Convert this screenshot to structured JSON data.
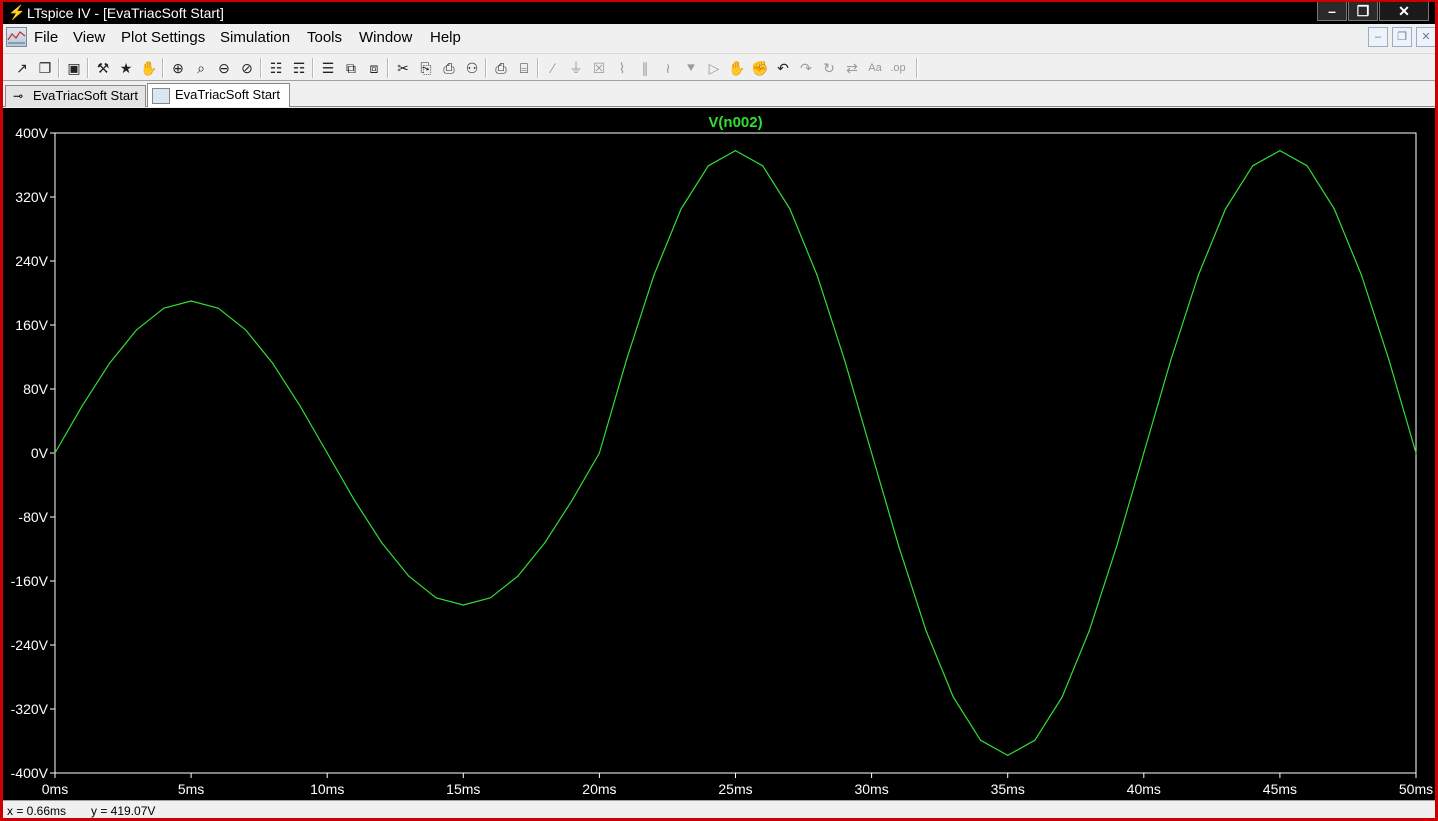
{
  "window": {
    "title": "LTspice IV - [EvaTriacSoft Start]",
    "buttons": {
      "minimize": "–",
      "restore": "❐",
      "close": "✕"
    }
  },
  "menu": {
    "items": [
      "File",
      "View",
      "Plot Settings",
      "Simulation",
      "Tools",
      "Window",
      "Help"
    ],
    "mdi_buttons": [
      "–",
      "❐",
      "✕"
    ]
  },
  "toolbar": {
    "icons": [
      {
        "name": "new-schematic-icon",
        "glyph": "↗",
        "enabled": true
      },
      {
        "name": "open-icon",
        "glyph": "❐",
        "enabled": true
      },
      {
        "name": "save-icon",
        "glyph": "▣",
        "enabled": true
      },
      {
        "name": "control-panel-icon",
        "glyph": "⚒",
        "enabled": true
      },
      {
        "name": "run-icon",
        "glyph": "★",
        "enabled": true
      },
      {
        "name": "halt-icon",
        "glyph": "✋",
        "enabled": true
      },
      {
        "name": "zoom-area-icon",
        "glyph": "⊕",
        "enabled": true
      },
      {
        "name": "zoom-in-icon",
        "glyph": "⌕",
        "enabled": true
      },
      {
        "name": "zoom-out-icon",
        "glyph": "⊖",
        "enabled": true
      },
      {
        "name": "zoom-fit-icon",
        "glyph": "⊘",
        "enabled": true
      },
      {
        "name": "autorange-icon",
        "glyph": "☷",
        "enabled": true
      },
      {
        "name": "delete-traces-icon",
        "glyph": "☶",
        "enabled": true
      },
      {
        "name": "tile-horizontal-icon",
        "glyph": "☰",
        "enabled": true
      },
      {
        "name": "cascade-icon",
        "glyph": "⧉",
        "enabled": true
      },
      {
        "name": "tile-vertical-icon",
        "glyph": "⧈",
        "enabled": true
      },
      {
        "name": "cut-icon",
        "glyph": "✂",
        "enabled": true
      },
      {
        "name": "copy-icon",
        "glyph": "⎘",
        "enabled": true
      },
      {
        "name": "paste-icon",
        "glyph": "⎙",
        "enabled": true
      },
      {
        "name": "find-icon",
        "glyph": "⚇",
        "enabled": true
      },
      {
        "name": "print-setup-icon",
        "glyph": "⎙",
        "enabled": true
      },
      {
        "name": "print-icon",
        "glyph": "⌸",
        "enabled": true
      },
      {
        "name": "draw-wire-icon",
        "glyph": "∕",
        "enabled": false
      },
      {
        "name": "ground-icon",
        "glyph": "⏚",
        "enabled": false
      },
      {
        "name": "label-net-icon",
        "glyph": "☒",
        "enabled": false
      },
      {
        "name": "resistor-icon",
        "glyph": "⌇",
        "enabled": false
      },
      {
        "name": "capacitor-icon",
        "glyph": "∥",
        "enabled": false
      },
      {
        "name": "inductor-icon",
        "glyph": "≀",
        "enabled": false
      },
      {
        "name": "diode-icon",
        "glyph": "⯆",
        "enabled": false
      },
      {
        "name": "component-icon",
        "glyph": "▷",
        "enabled": false
      },
      {
        "name": "move-icon",
        "glyph": "✋",
        "enabled": false
      },
      {
        "name": "drag-icon",
        "glyph": "✊",
        "enabled": true
      },
      {
        "name": "undo-icon",
        "glyph": "↶",
        "enabled": true
      },
      {
        "name": "redo-icon",
        "glyph": "↷",
        "enabled": false
      },
      {
        "name": "rotate-icon",
        "glyph": "↻",
        "enabled": false
      },
      {
        "name": "mirror-icon",
        "glyph": "⇄",
        "enabled": false
      },
      {
        "name": "text-icon",
        "glyph": "Aa",
        "enabled": false
      },
      {
        "name": "spice-directive-icon",
        "glyph": ".op",
        "enabled": false
      }
    ]
  },
  "tabs": [
    {
      "label": "EvaTriacSoft Start",
      "icon": "schematic-icon",
      "active": false
    },
    {
      "label": "EvaTriacSoft Start",
      "icon": "waveform-icon",
      "active": true
    }
  ],
  "status": {
    "x": "x = 0.66ms",
    "y": "y = 419.07V"
  },
  "colors": {
    "background": "#000000",
    "trace": "#33dd33",
    "axes": "#ffffff",
    "window_border": "#cc0000"
  },
  "chart_data": {
    "type": "line",
    "title": "V(n002)",
    "xlabel": "",
    "ylabel": "",
    "xlim": [
      0,
      50
    ],
    "ylim": [
      -400,
      400
    ],
    "xunit": "ms",
    "yunit": "V",
    "x_ticks": [
      "0ms",
      "5ms",
      "10ms",
      "15ms",
      "20ms",
      "25ms",
      "30ms",
      "35ms",
      "40ms",
      "45ms",
      "50ms"
    ],
    "y_ticks": [
      "400V",
      "320V",
      "240V",
      "160V",
      "80V",
      "0V",
      "-80V",
      "-160V",
      "-240V",
      "-320V",
      "-400V"
    ],
    "grid": false,
    "series": [
      {
        "name": "V(n002)",
        "x": [
          0,
          1,
          2,
          3,
          4,
          5,
          6,
          7,
          8,
          9,
          10,
          11,
          12,
          13,
          14,
          15,
          16,
          17,
          18,
          19,
          20,
          21,
          22,
          23,
          24,
          25,
          26,
          27,
          28,
          29,
          30,
          31,
          32,
          33,
          34,
          35,
          36,
          37,
          38,
          39,
          40,
          41,
          42,
          43,
          44,
          45,
          46,
          47,
          48,
          49,
          50
        ],
        "values": [
          0,
          59,
          112,
          154,
          181,
          190,
          181,
          154,
          112,
          59,
          0,
          -59,
          -112,
          -154,
          -181,
          -190,
          -181,
          -154,
          -112,
          -59,
          0,
          117,
          222,
          305,
          359,
          378,
          359,
          305,
          222,
          117,
          0,
          -117,
          -222,
          -305,
          -359,
          -378,
          -359,
          -305,
          -222,
          -117,
          0,
          117,
          222,
          305,
          359,
          378,
          359,
          305,
          222,
          117,
          0
        ]
      }
    ]
  }
}
